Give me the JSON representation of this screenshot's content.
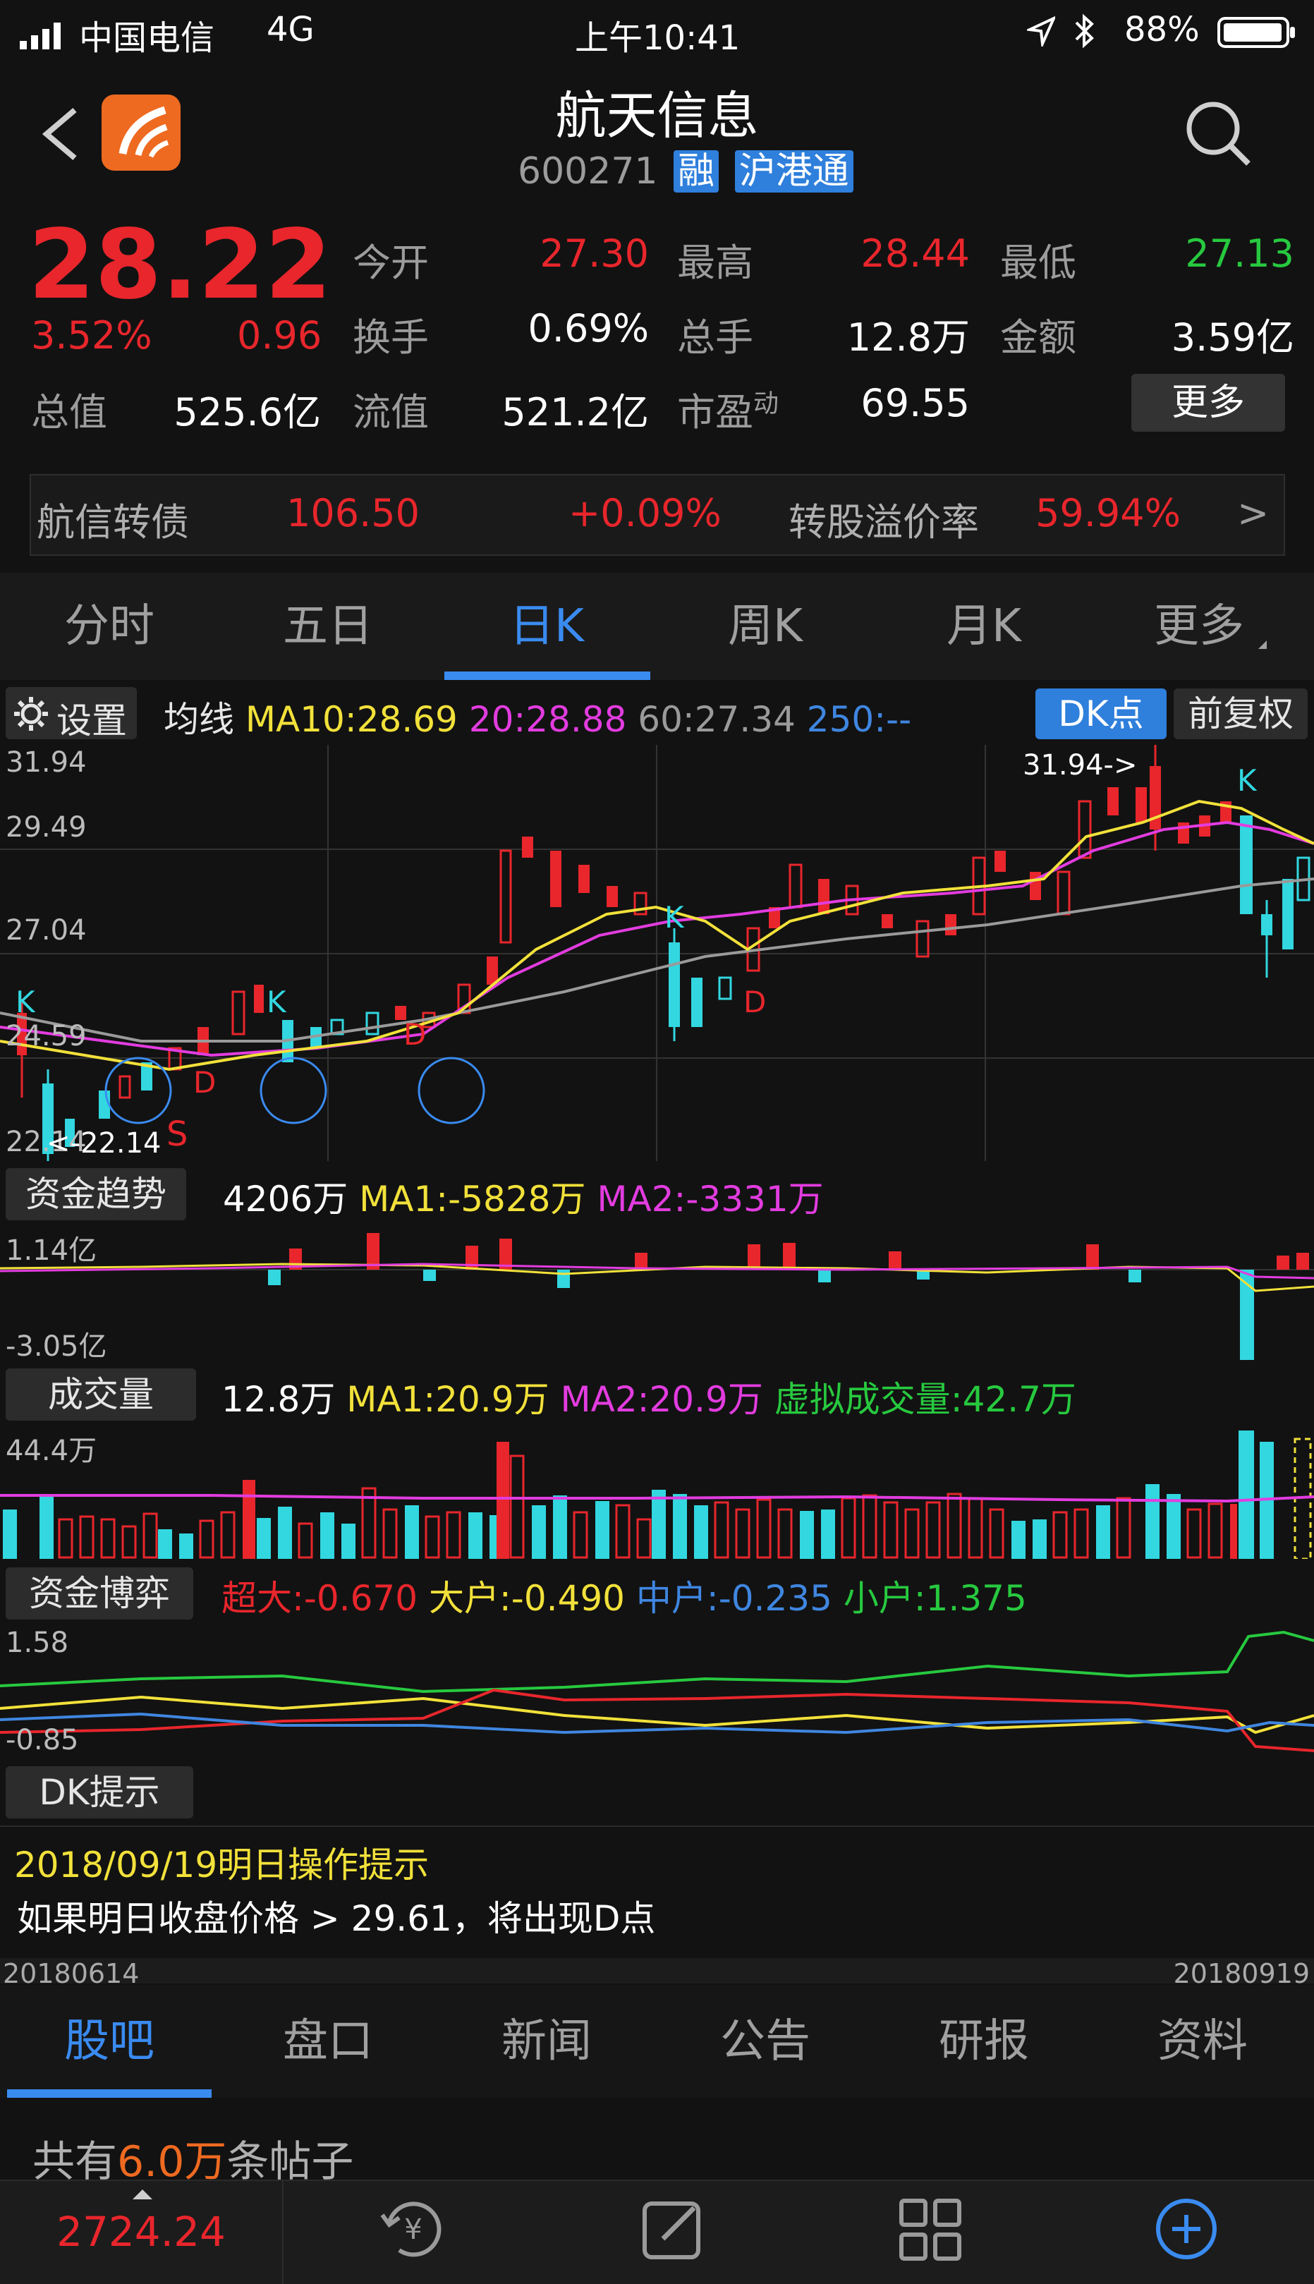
{
  "status_bar": {
    "carrier": "中国电信",
    "network": "4G",
    "time": "上午10:41",
    "battery": "88%"
  },
  "header": {
    "title": "航天信息",
    "code": "600271",
    "badge_margin": "融",
    "badge_connect": "沪港通"
  },
  "quote": {
    "price": "28.22",
    "change_pct": "3.52%",
    "change": "0.96",
    "open_label": "今开",
    "open": "27.30",
    "high_label": "最高",
    "high": "28.44",
    "low_label": "最低",
    "low": "27.13",
    "turnover_label": "换手",
    "turnover": "0.69%",
    "volume_label": "总手",
    "volume": "12.8万",
    "amount_label": "金额",
    "amount": "3.59亿",
    "mktcap_label": "总值",
    "mktcap": "525.6亿",
    "float_label": "流值",
    "float": "521.2亿",
    "pe_label": "市盈",
    "pe_sup": "动",
    "pe": "69.55",
    "more": "更多"
  },
  "bond": {
    "name": "航信转债",
    "price": "106.50",
    "change": "+0.09%",
    "premium_label": "转股溢价率",
    "premium": "59.94%",
    "arrow": ">"
  },
  "tabs": [
    "分时",
    "五日",
    "日K",
    "周K",
    "月K",
    "更多"
  ],
  "kline": {
    "settings": "设置",
    "ma_label": "均线",
    "ma10": "MA10:28.69",
    "ma20": "20:28.88",
    "ma60": "60:27.34",
    "ma250": "250:--",
    "dk_button": "DK点",
    "adjust_button": "前复权",
    "y_top": "31.94",
    "y2": "29.49",
    "y3": "27.04",
    "y4": "24.59",
    "y_bottom": "22.14",
    "max_marker": "31.94->",
    "min_marker": "<-22.14",
    "signal_k": "K",
    "signal_d": "D",
    "signal_s": "S"
  },
  "capital_trend": {
    "label": "资金趋势",
    "value": "4206万",
    "ma1": "MA1:-5828万",
    "ma2": "MA2:-3331万",
    "top": "1.14亿",
    "bottom": "-3.05亿"
  },
  "volume_panel": {
    "label": "成交量",
    "value": "12.8万",
    "ma1": "MA1:20.9万",
    "ma2": "MA2:20.9万",
    "virtual": "虚拟成交量:42.7万",
    "top": "44.4万"
  },
  "capital_game": {
    "label": "资金博弈",
    "super": "超大:-0.670",
    "large": "大户:-0.490",
    "medium": "中户:-0.235",
    "small": "小户:1.375",
    "top": "1.58",
    "bottom": "-0.85"
  },
  "dk_tip": {
    "label": "DK提示",
    "date_line": "2018/09/19明日操作提示",
    "text": "如果明日收盘价格 > 29.61，将出现D点"
  },
  "date_range": {
    "start": "20180614",
    "end": "20180919"
  },
  "bottom_tabs": [
    "股吧",
    "盘口",
    "新闻",
    "公告",
    "研报",
    "资料"
  ],
  "posts": {
    "prefix": "共有",
    "count": "6.0万",
    "suffix": "条帖子"
  },
  "index_value": "2724.24",
  "colors": {
    "up": "#e8262c",
    "down": "#32d7e0",
    "accent": "#3a8bf0",
    "ma10": "#f2e13a",
    "ma20": "#e23cdf",
    "ma60": "#9a9a9a"
  }
}
